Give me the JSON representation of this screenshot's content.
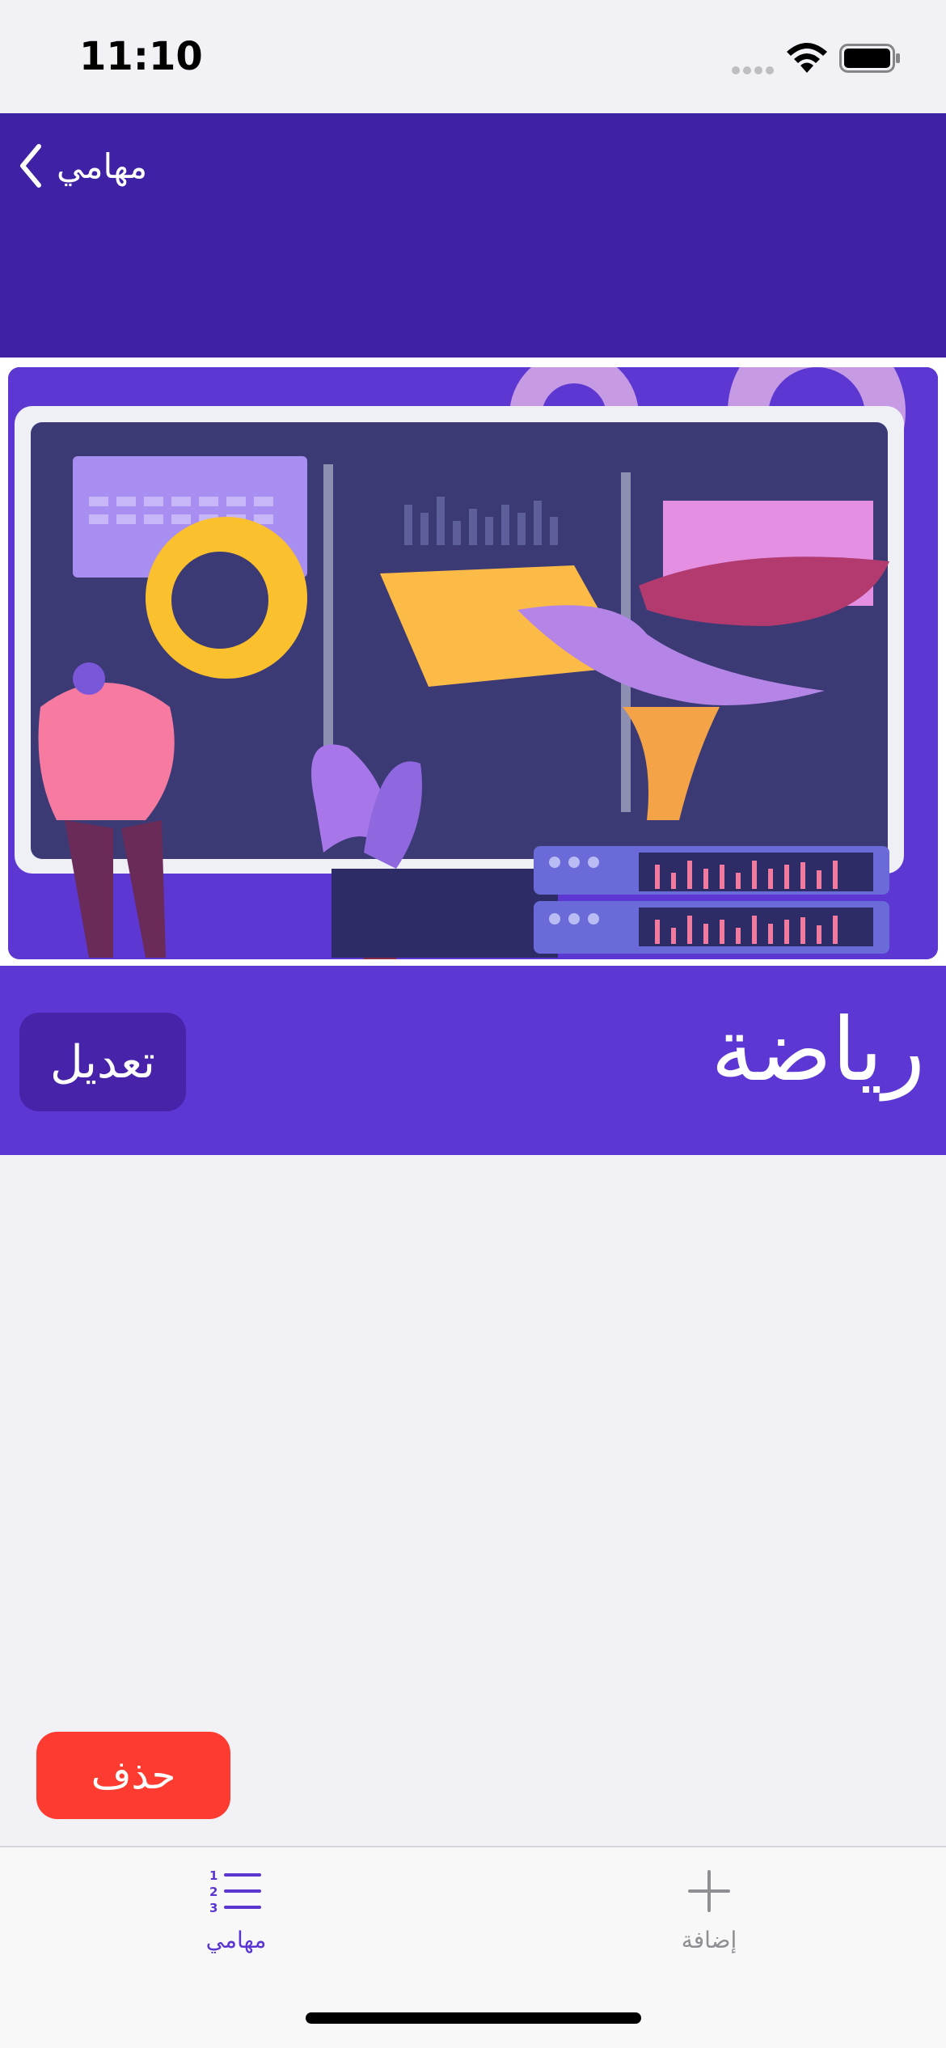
{
  "status_bar": {
    "time": "11:10"
  },
  "nav": {
    "back_label": "مهامي"
  },
  "task": {
    "title": "رياضة"
  },
  "actions": {
    "edit_label": "تعديل",
    "delete_label": "حذف"
  },
  "tabs": [
    {
      "label": "مهامي",
      "icon": "numbered-list-icon",
      "active": true
    },
    {
      "label": "إضافة",
      "icon": "plus-icon",
      "active": false
    }
  ],
  "colors": {
    "header": "#3e21a4",
    "title_band": "#5d37d4",
    "edit_button": "#4623a8",
    "delete_button": "#fe3b30",
    "active_tab": "#5a36d0"
  }
}
